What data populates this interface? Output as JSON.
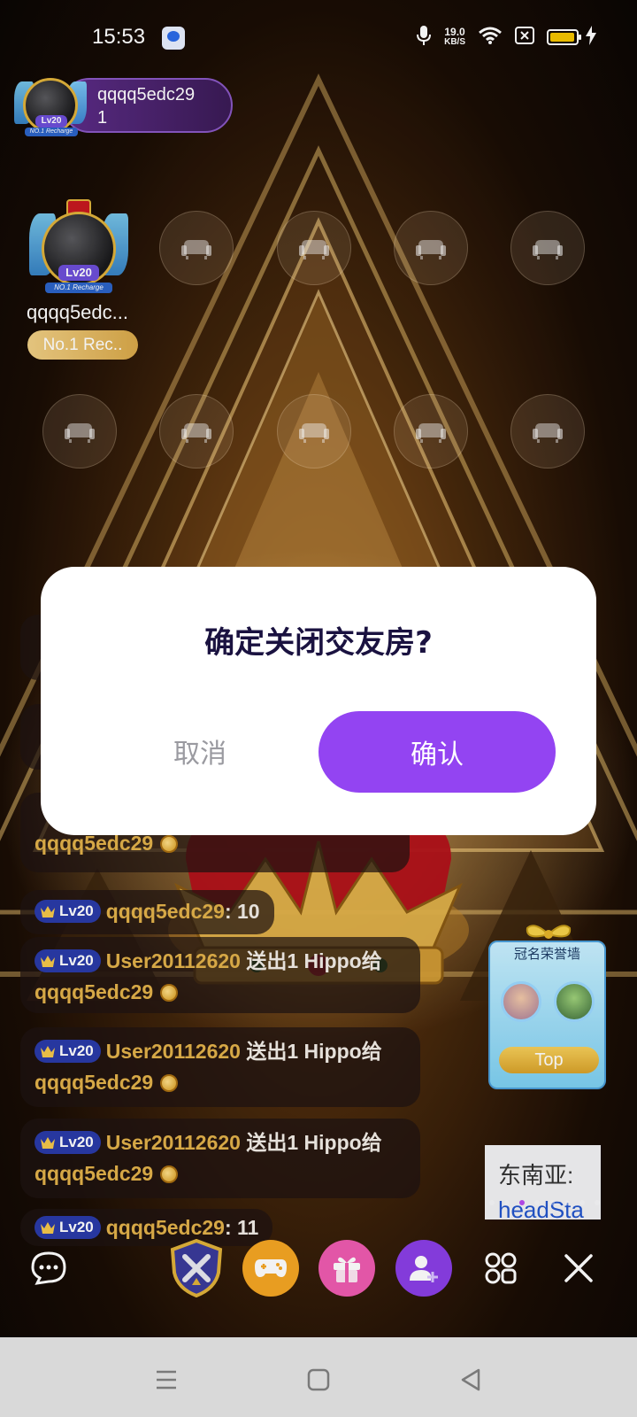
{
  "status_bar": {
    "time": "15:53",
    "net_speed_value": "19.0",
    "net_speed_unit": "KB/S",
    "battery_level": 0.85,
    "battery_color": "#f5c400"
  },
  "host": {
    "name": "qqqq5edc29",
    "count": "1",
    "level": "Lv20",
    "rank_label": "NO.1 Recharge"
  },
  "seat_host": {
    "name": "qqqq5edc...",
    "level": "Lv20",
    "rank_label": "NO.1 Recharge",
    "tag": "No.1 Rec.."
  },
  "chat": {
    "messages": [
      {
        "badge": "Lv20",
        "user": "qqqq5edc29",
        "text": ": 10"
      },
      {
        "badge": "Lv20",
        "user": "User20112620",
        "text": "送出1 Hippo给",
        "target": "qqqq5edc29"
      },
      {
        "badge": "Lv20",
        "user": "User20112620",
        "text": "送出1 Hippo给",
        "target": "qqqq5edc29"
      },
      {
        "badge": "Lv20",
        "user": "User20112620",
        "text": "送出1 Hippo给",
        "target": "qqqq5edc29"
      },
      {
        "badge": "Lv20",
        "user": "qqqq5edc29",
        "text": ": 11"
      }
    ],
    "partial_target": "qqqq5edc29"
  },
  "honor_wall": {
    "title": "冠名荣誉墙",
    "button": "Top"
  },
  "region_banner": {
    "line1": "东南亚:",
    "line2": "headSta"
  },
  "toolbar": {
    "icons": [
      "chat-icon",
      "battle-icon",
      "game-icon",
      "gift-icon",
      "add-user-icon",
      "grid-icon",
      "close-icon"
    ],
    "accent_orange": "#f5a623",
    "accent_pink": "#ef5bb0",
    "accent_purple": "#8b3fe6"
  },
  "dialog": {
    "title": "确定关闭交友房?",
    "cancel_label": "取消",
    "confirm_label": "确认",
    "confirm_color": "#9344f2"
  }
}
